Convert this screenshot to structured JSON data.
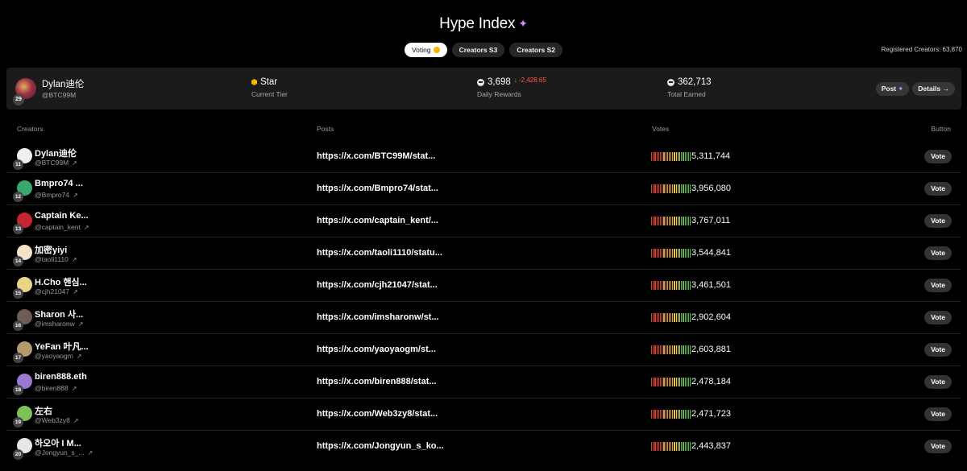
{
  "header": {
    "title": "Hype Index",
    "sparkle_icon": "sparkle-icon"
  },
  "tabs": [
    {
      "label": "Voting",
      "active": true
    },
    {
      "label": "Creators S3",
      "active": false
    },
    {
      "label": "Creators S2",
      "active": false
    }
  ],
  "registered_creators": "Registered Creators: 63,870",
  "my_card": {
    "rank": "29",
    "name": "Dylan迪伦",
    "handle": "@BTC99M",
    "tier_value": "Star",
    "tier_label": "Current Tier",
    "daily_rewards_value": "3,698",
    "daily_rewards_change": "↓ -2,428.65",
    "daily_rewards_label": "Daily Rewards",
    "total_earned_value": "362,713",
    "total_earned_label": "Total Earned",
    "post_label": "Post",
    "details_label": "Details →"
  },
  "table": {
    "headers": {
      "creators": "Creators",
      "posts": "Posts",
      "votes": "Votes",
      "button": "Button"
    },
    "rows": [
      {
        "rank": "11",
        "name": "Dylan迪伦",
        "handle": "@BTC99M",
        "post": "https://x.com/BTC99M/stat...",
        "votes": "5,311,744",
        "vote_label": "Vote"
      },
      {
        "rank": "12",
        "name": "Bmpro74 ...",
        "handle": "@Bmpro74",
        "post": "https://x.com/Bmpro74/stat...",
        "votes": "3,956,080",
        "vote_label": "Vote"
      },
      {
        "rank": "13",
        "name": "Captain Ke...",
        "handle": "@captain_kent",
        "post": "https://x.com/captain_kent/...",
        "votes": "3,767,011",
        "vote_label": "Vote"
      },
      {
        "rank": "14",
        "name": "加密yiyi",
        "handle": "@taoli1110",
        "post": "https://x.com/taoli1110/statu...",
        "votes": "3,544,841",
        "vote_label": "Vote"
      },
      {
        "rank": "15",
        "name": "H.Cho 핸심...",
        "handle": "@cjh21047",
        "post": "https://x.com/cjh21047/stat...",
        "votes": "3,461,501",
        "vote_label": "Vote"
      },
      {
        "rank": "16",
        "name": "Sharon 사...",
        "handle": "@imsharonw",
        "post": "https://x.com/imsharonw/st...",
        "votes": "2,902,604",
        "vote_label": "Vote"
      },
      {
        "rank": "17",
        "name": "YeFan 叶凡...",
        "handle": "@yaoyaogm",
        "post": "https://x.com/yaoyaogm/st...",
        "votes": "2,603,881",
        "vote_label": "Vote"
      },
      {
        "rank": "18",
        "name": "biren888.eth",
        "handle": "@biren888",
        "post": "https://x.com/biren888/stat...",
        "votes": "2,478,184",
        "vote_label": "Vote"
      },
      {
        "rank": "19",
        "name": "左右",
        "handle": "@Web3zy8",
        "post": "https://x.com/Web3zy8/stat...",
        "votes": "2,471,723",
        "vote_label": "Vote"
      },
      {
        "rank": "20",
        "name": "하오아 I M...",
        "handle": "@Jongyun_s_...",
        "post": "https://x.com/Jongyun_s_ko...",
        "votes": "2,443,837",
        "vote_label": "Vote"
      }
    ]
  },
  "colors": {
    "background": "#000000",
    "card": "#1b1b1b",
    "negative": "#ff5a4a",
    "sparkle": "#c58bff",
    "coin": "#f5b400"
  }
}
